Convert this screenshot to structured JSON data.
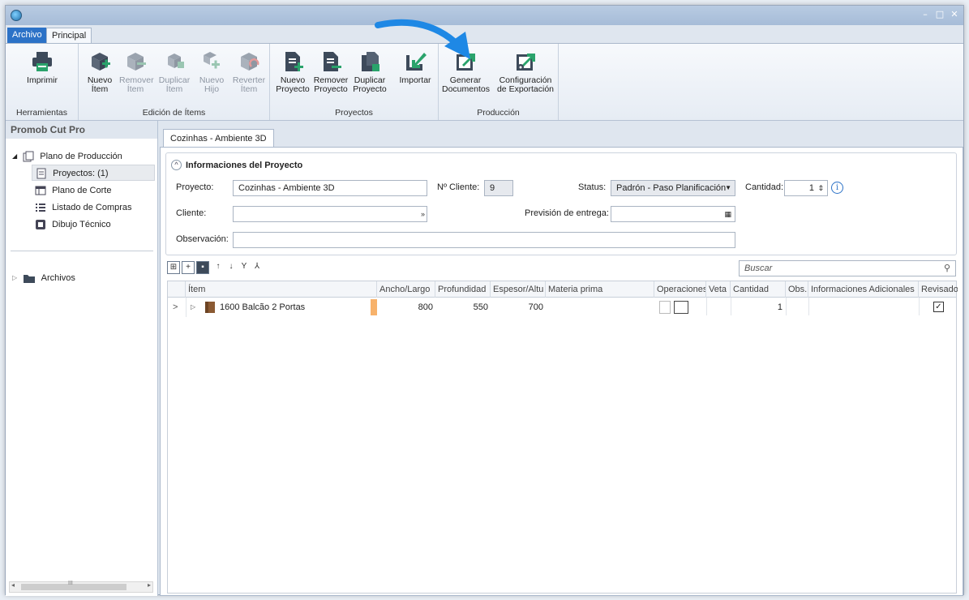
{
  "tabs": {
    "file": "Archivo",
    "main": "Principal"
  },
  "ribbon": {
    "groups": {
      "tools": "Herramientas",
      "items": "Edición de Ítems",
      "projects": "Proyectos",
      "production": "Producción"
    },
    "buttons": {
      "print": "Imprimir",
      "new_item": [
        "Nuevo",
        "Ítem"
      ],
      "remove_item": [
        "Remover",
        "Ítem"
      ],
      "duplicate_item": [
        "Duplicar",
        "Ítem"
      ],
      "new_child": [
        "Nuevo",
        "Hijo"
      ],
      "revert_item": [
        "Reverter",
        "Ítem"
      ],
      "new_project": [
        "Nuevo",
        "Proyecto"
      ],
      "remove_project": [
        "Remover",
        "Proyecto"
      ],
      "duplicate_project": [
        "Duplicar",
        "Proyecto"
      ],
      "import": "Importar",
      "generate_docs": [
        "Generar",
        "Documentos"
      ],
      "export_config": [
        "Configuración",
        "de Exportación"
      ]
    }
  },
  "left_panel": {
    "title": "Promob Cut Pro",
    "tree": {
      "production_plan": "Plano de Producción",
      "projects": "Proyectos: (1)",
      "cut_plan": "Plano de Corte",
      "purchase_list": "Listado de Compras",
      "tech_drawing": "Dibujo Técnico",
      "files": "Archivos"
    },
    "scroll_thumb": "III"
  },
  "document": {
    "tab": "Cozinhas - Ambiente 3D",
    "info": {
      "title": "Informaciones del Proyecto",
      "project_label": "Proyecto:",
      "project_value": "Cozinhas - Ambiente 3D",
      "client_no_label": "Nº Cliente:",
      "client_no_value": "9",
      "status_label": "Status:",
      "status_value": "Padrón - Paso Planificación",
      "quantity_label": "Cantidad:",
      "quantity_value": "1",
      "client_label": "Cliente:",
      "delivery_label": "Previsión de entrega:",
      "observation_label": "Observación:"
    },
    "search_placeholder": "Buscar",
    "grid": {
      "columns": [
        "Ítem",
        "Ancho/Largo",
        "Profundidad",
        "Espesor/Altu",
        "Materia prima",
        "Operaciones",
        "Veta",
        "Cantidad",
        "Obs.",
        "Informaciones Adicionales",
        "Revisado"
      ],
      "row": {
        "item": "1600 Balcão 2 Portas",
        "ancho": "800",
        "profundidad": "550",
        "espesor": "700",
        "materia": "",
        "cantidad": "1",
        "revisado": "✓"
      }
    }
  },
  "colors": {
    "accent": "#2c72c7",
    "highlight_arrow": "#1e88e5",
    "row_marker": "#f7b26b"
  }
}
